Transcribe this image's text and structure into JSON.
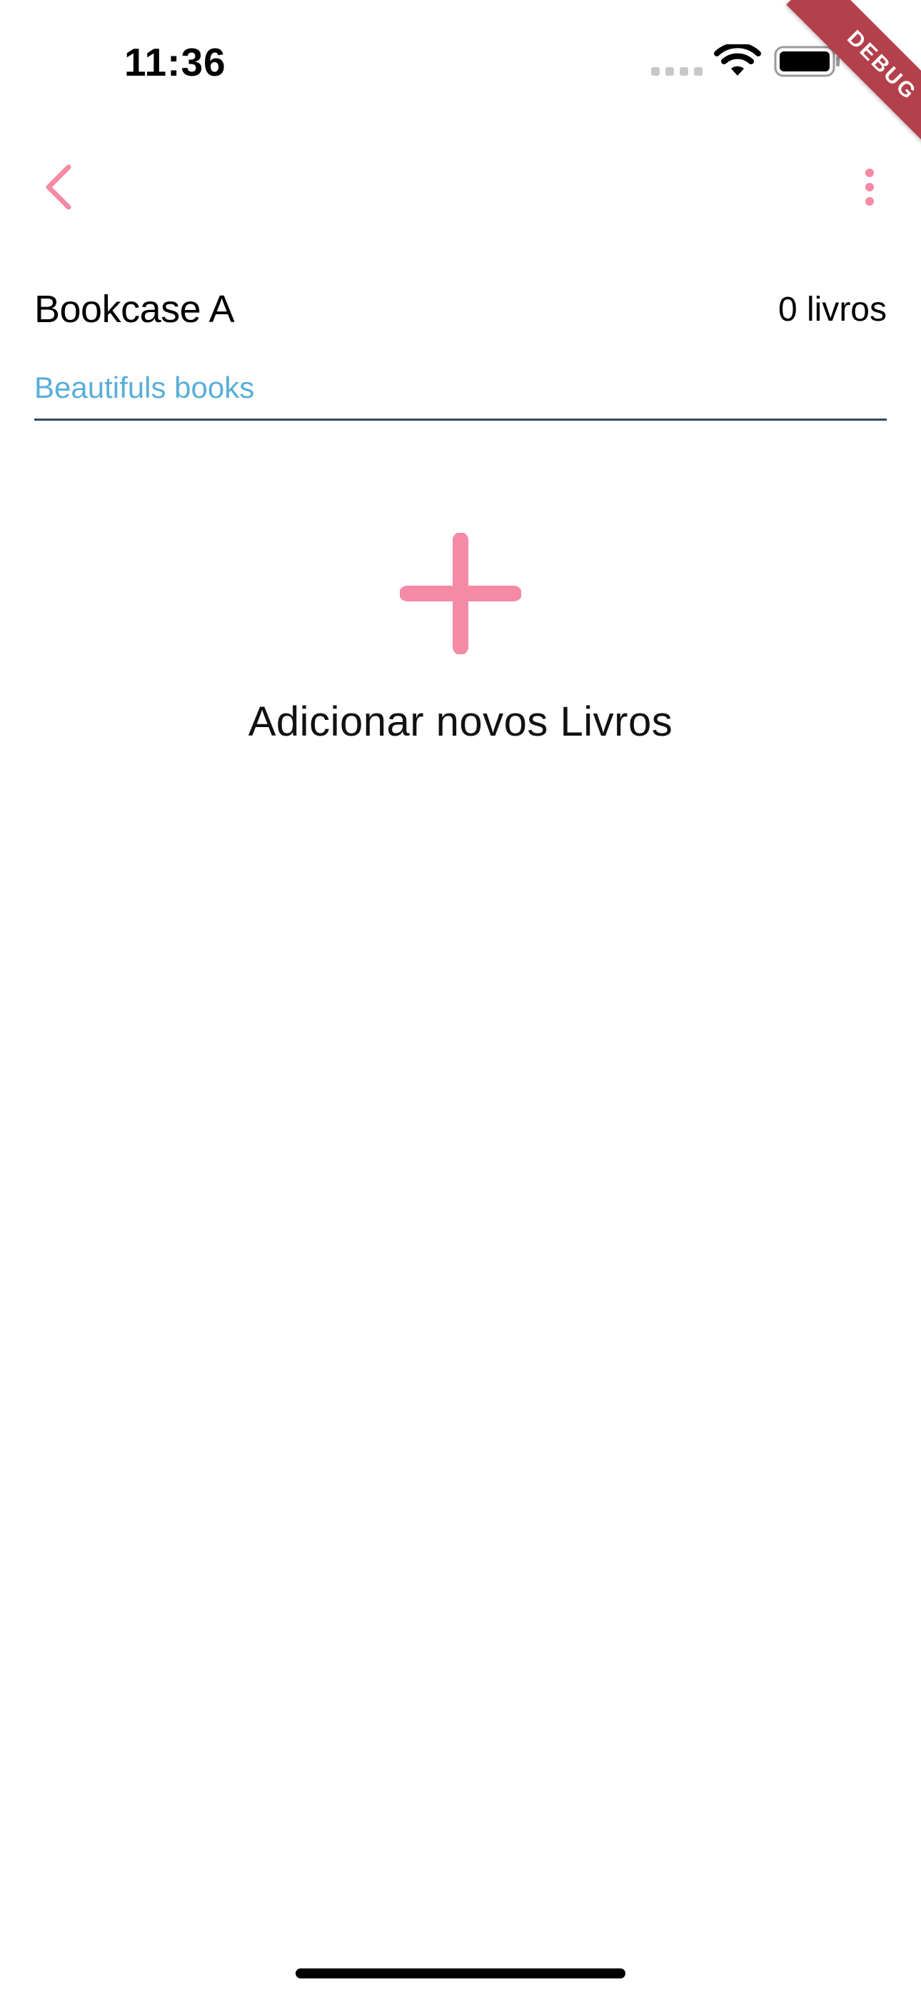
{
  "status_bar": {
    "time": "11:36",
    "icons": [
      "cellular-dots-icon",
      "wifi-icon",
      "battery-icon"
    ]
  },
  "debug_banner": {
    "label": "DEBUG",
    "color": "#b3404a"
  },
  "app_bar": {
    "back_icon": "chevron-left-icon",
    "menu_icon": "more-vertical-icon",
    "accent_color": "#f48aa5"
  },
  "header": {
    "title": "Bookcase A",
    "book_count": "0 livros",
    "description_value": "Beautifuls books",
    "description_color": "#5aaed8"
  },
  "empty_state": {
    "icon": "plus-icon",
    "label": "Adicionar novos Livros"
  }
}
